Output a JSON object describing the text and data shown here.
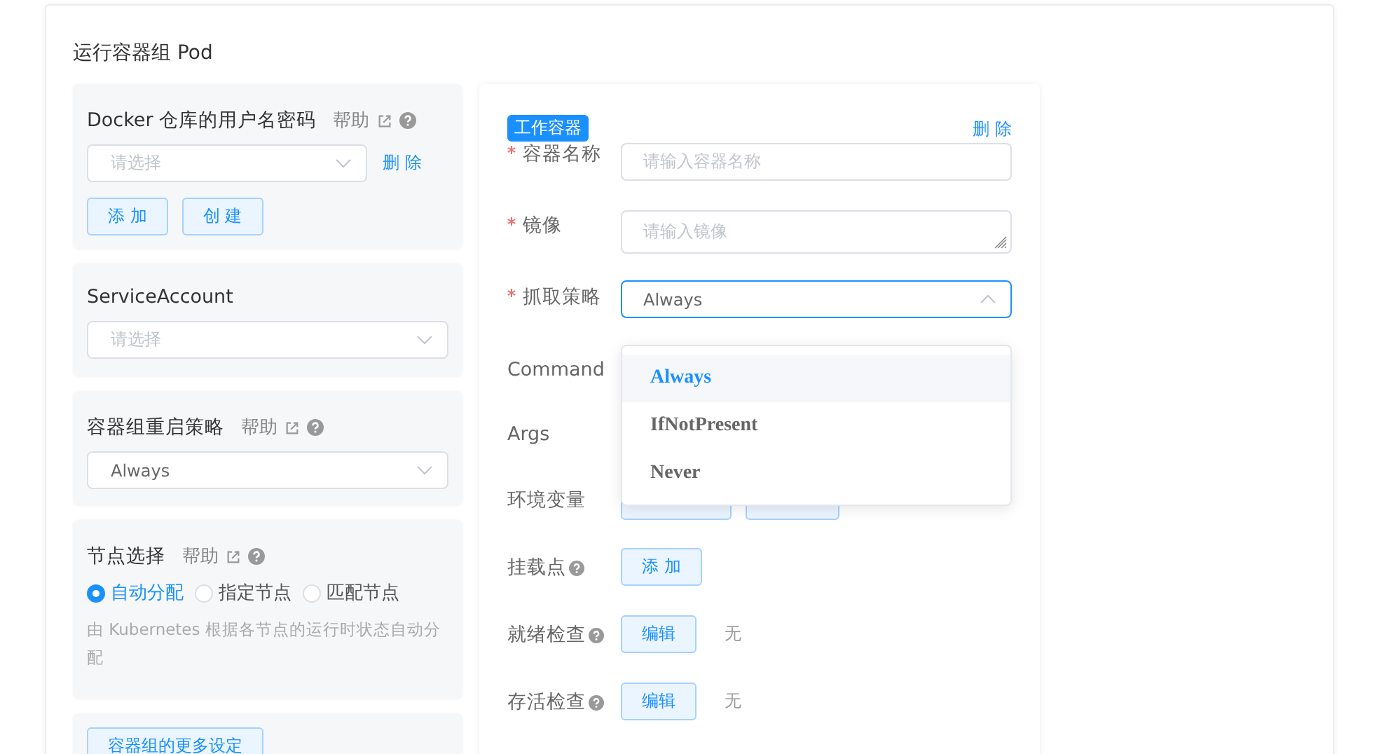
{
  "section_title": "运行容器组 Pod",
  "docker_credentials": {
    "title": "Docker 仓库的用户名密码",
    "help": "帮助",
    "select_placeholder": "请选择",
    "delete": "删 除",
    "buttons": [
      "添 加",
      "创 建"
    ]
  },
  "service_account": {
    "title": "ServiceAccount",
    "select_placeholder": "请选择"
  },
  "restart_policy": {
    "title": "容器组重启策略",
    "help": "帮助",
    "select_value": "Always"
  },
  "node_selection": {
    "title": "节点选择",
    "help": "帮助",
    "options": [
      {
        "label": "自动分配",
        "selected": true
      },
      {
        "label": "指定节点",
        "selected": false
      },
      {
        "label": "匹配节点",
        "selected": false
      }
    ],
    "description": "由 Kubernetes 根据各节点的运行时状态自动分配"
  },
  "more_settings_button": "容器组的更多设定",
  "container": {
    "tag": "工作容器",
    "delete": "删 除",
    "fields": [
      {
        "kind": "input",
        "label": "容器名称",
        "required": true,
        "placeholder": "请输入容器名称"
      },
      {
        "kind": "textarea",
        "label": "镜像",
        "required": true,
        "placeholder": "请输入镜像"
      },
      {
        "kind": "select",
        "label": "抓取策略",
        "required": true,
        "value": "Always",
        "expanded": true
      },
      {
        "kind": "empty",
        "label": "Command"
      },
      {
        "kind": "empty",
        "label": "Args"
      },
      {
        "kind": "covered_buttons",
        "label": "环境变量"
      },
      {
        "kind": "buttons",
        "label": "挂载点",
        "help_icon": true,
        "buttons": [
          "添 加"
        ]
      },
      {
        "kind": "buttons",
        "label": "就绪检查",
        "help_icon": true,
        "buttons": [
          "编辑"
        ],
        "note": "无"
      },
      {
        "kind": "buttons",
        "label": "存活检查",
        "help_icon": true,
        "buttons": [
          "编辑"
        ],
        "note": "无"
      }
    ]
  },
  "dropdown": {
    "options": [
      {
        "label": "Always",
        "selected": true
      },
      {
        "label": "IfNotPresent",
        "selected": false
      },
      {
        "label": "Never",
        "selected": false
      }
    ]
  }
}
